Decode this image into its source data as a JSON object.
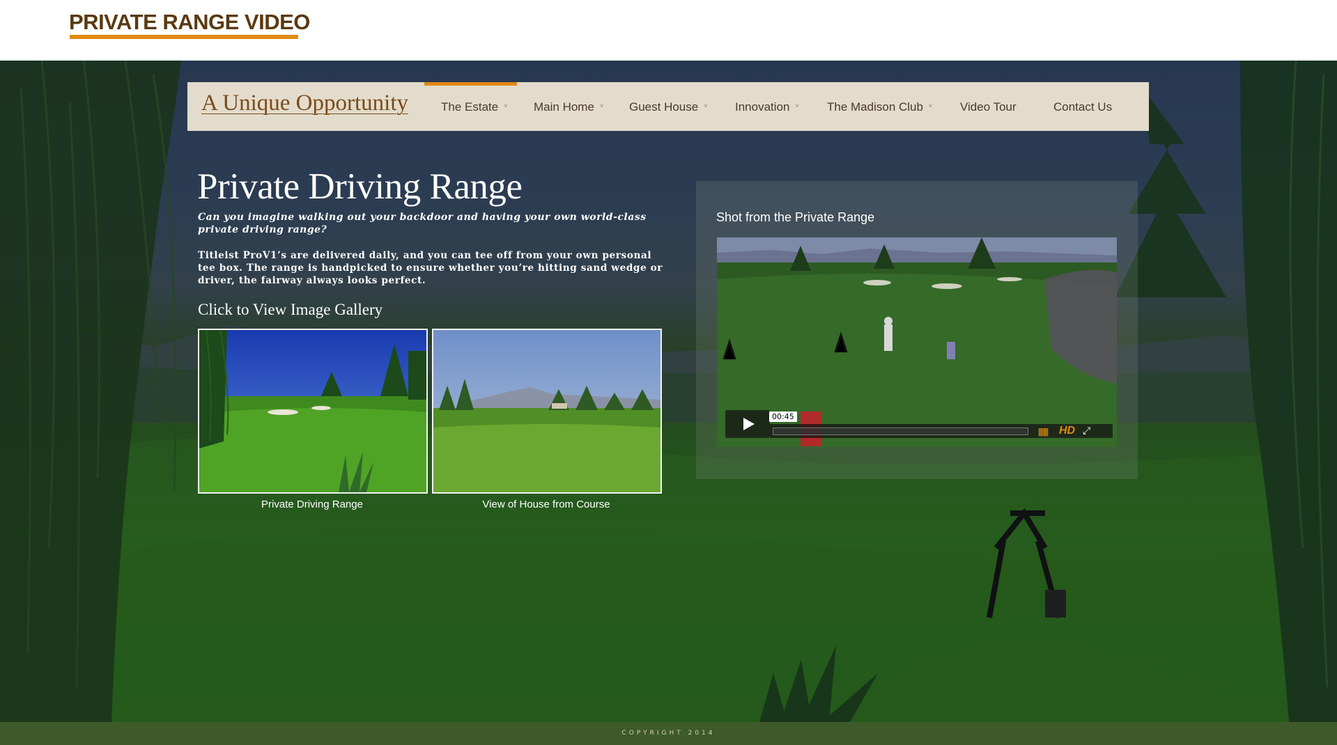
{
  "header": {
    "brand_title": "PRIVATE RANGE VIDEO",
    "brand_color": "#5a3a10",
    "accent_color": "#e08a14"
  },
  "nav": {
    "logo": "A Unique Opportunity",
    "items": [
      {
        "label": "The Estate",
        "has_caret": true,
        "active": true
      },
      {
        "label": "Main Home",
        "has_caret": true,
        "active": false
      },
      {
        "label": "Guest House",
        "has_caret": true,
        "active": false
      },
      {
        "label": "Innovation",
        "has_caret": true,
        "active": false
      },
      {
        "label": "The Madison Club",
        "has_caret": true,
        "active": false
      },
      {
        "label": "Video Tour",
        "has_caret": false,
        "active": false
      },
      {
        "label": "Contact Us",
        "has_caret": false,
        "active": false
      }
    ],
    "caret_glyph": "˅"
  },
  "content": {
    "title": "Private Driving Range",
    "lead": "Can you imagine walking out your backdoor and having your own world-class private driving range?",
    "body": "Titleist ProV1’s are delivered daily, and you can tee off from your own personal tee box. The range is handpicked to ensure whether you’re hitting sand wedge or driver, the fairway always looks perfect.",
    "gallery_title": "Click to View Image Gallery",
    "gallery": [
      {
        "caption": "Private Driving Range"
      },
      {
        "caption": "View of House from Course"
      }
    ]
  },
  "video": {
    "title": "Shot from the Private Range",
    "time": "00:45",
    "hd_label": "HD",
    "icons": [
      "play-icon",
      "volume-icon",
      "fullscreen-icon"
    ]
  },
  "footer": {
    "copyright": "COPYRIGHT 2014"
  }
}
